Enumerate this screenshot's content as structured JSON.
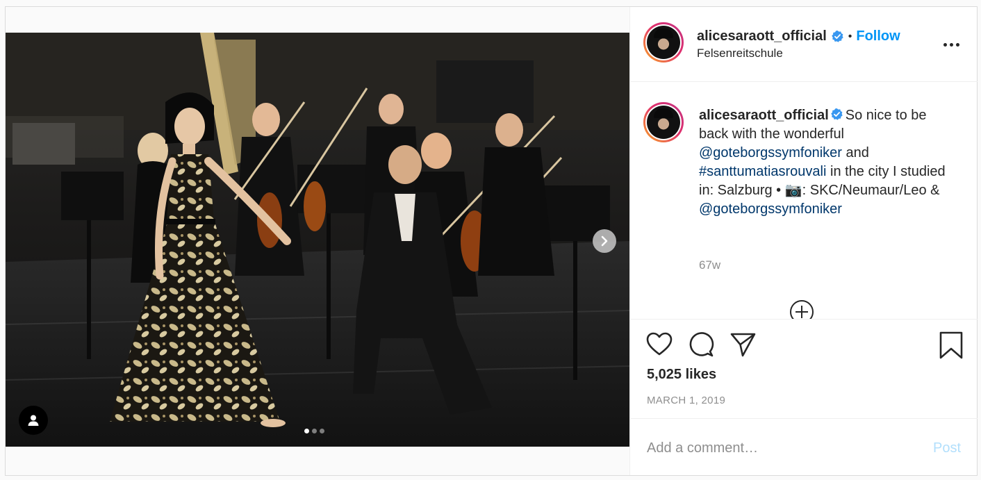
{
  "header": {
    "username": "alicesaraott_official",
    "separator": "•",
    "follow_label": "Follow",
    "location": "Felsenreitschule"
  },
  "caption": {
    "username": "alicesaraott_official",
    "text_1": "So nice to be back with the wonderful ",
    "mention_1": "@goteborgssymfoniker",
    "text_2": " and ",
    "hashtag": "#santtumatiasrouvali",
    "text_3": " in the city I studied in: Salzburg • 📷: SKC/Neumaur/Leo & ",
    "mention_2": "@goteborgssymfoniker",
    "time_ago": "67w"
  },
  "actions": {
    "like_icon": "heart-icon",
    "comment_icon": "comment-icon",
    "share_icon": "share-icon",
    "save_icon": "bookmark-icon"
  },
  "likes": "5,025 likes",
  "date": "MARCH 1, 2019",
  "comment": {
    "placeholder": "Add a comment…",
    "post_label": "Post"
  },
  "carousel": {
    "total": 3,
    "active_index": 0
  },
  "colors": {
    "accent": "#0095f6",
    "link": "#00376b",
    "muted": "#8e8e8e",
    "post_disabled": "#b2dffc"
  }
}
